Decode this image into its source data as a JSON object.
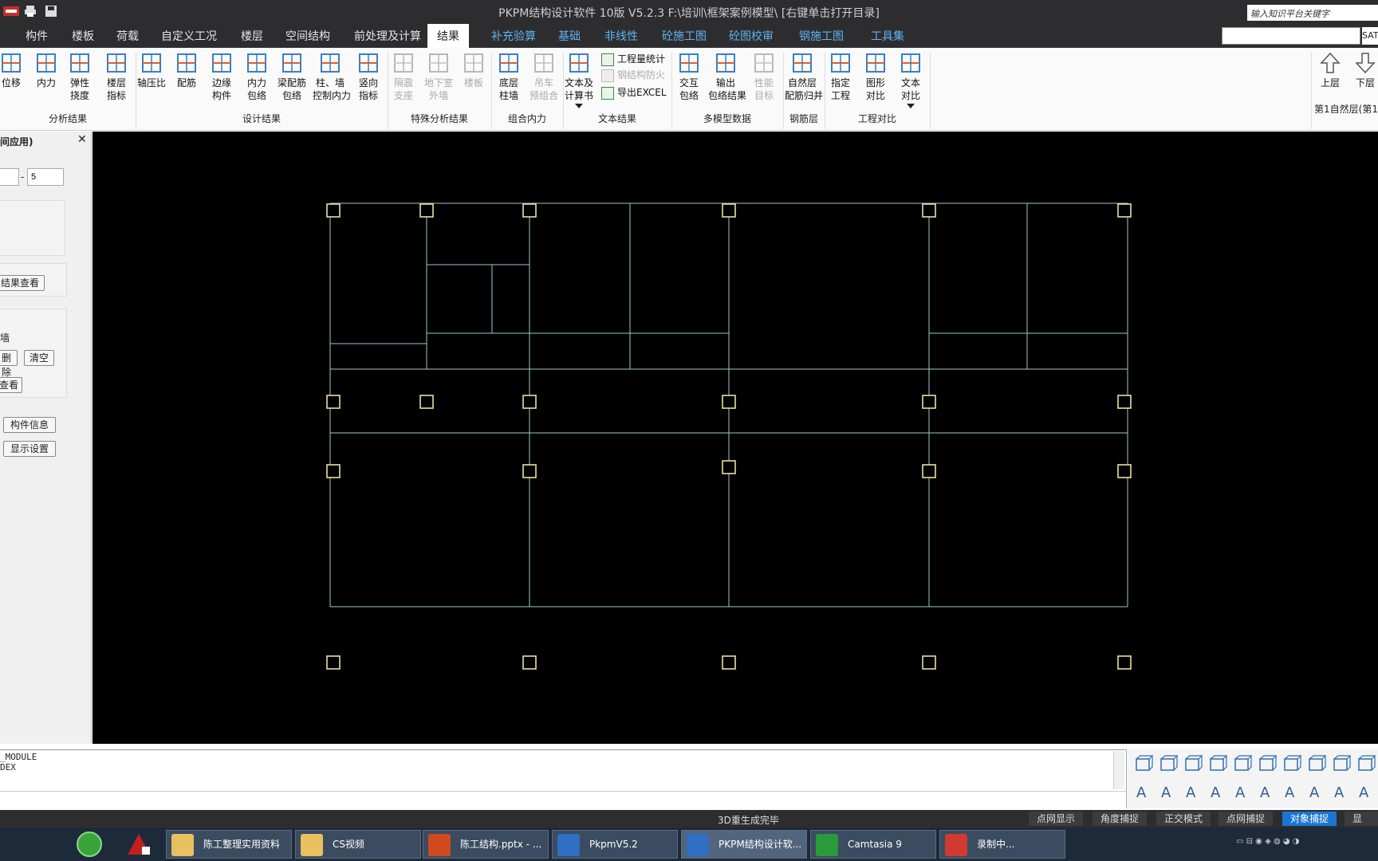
{
  "titlebar": {
    "title": "PKPM结构设计软件 10版 V5.2.3 F:\\培训\\框架案例模型\\  [右键单击打开目录]",
    "search_placeholder": "输入知识平台关键字"
  },
  "menu": {
    "tabs": [
      {
        "label": "构件",
        "style": "normal"
      },
      {
        "label": "楼板",
        "style": "normal"
      },
      {
        "label": "荷载",
        "style": "normal"
      },
      {
        "label": "自定义工况",
        "style": "normal"
      },
      {
        "label": "楼层",
        "style": "normal"
      },
      {
        "label": "空间结构",
        "style": "normal"
      },
      {
        "label": "前处理及计算",
        "style": "normal"
      },
      {
        "label": "结果",
        "style": "active"
      },
      {
        "label": "补充验算",
        "style": "blue"
      },
      {
        "label": "基础",
        "style": "blue"
      },
      {
        "label": "非线性",
        "style": "blue"
      },
      {
        "label": "砼施工图",
        "style": "blue"
      },
      {
        "label": "砼图校审",
        "style": "blue"
      },
      {
        "label": "钢施工图",
        "style": "blue"
      },
      {
        "label": "工具集",
        "style": "blue"
      }
    ],
    "combo_value": "",
    "combo2_value": "SAT"
  },
  "ribbon": {
    "buttons": [
      {
        "label": "位移",
        "enabled": true,
        "icon": "displacement-icon"
      },
      {
        "label": "内力",
        "enabled": true,
        "icon": "internal-force-icon"
      },
      {
        "label": "弹性\n挠度",
        "enabled": true,
        "icon": "deflection-icon"
      },
      {
        "label": "楼层\n指标",
        "enabled": true,
        "icon": "floor-index-icon"
      },
      {
        "label": "轴压比",
        "enabled": true,
        "icon": "axial-ratio-icon"
      },
      {
        "label": "配筋",
        "enabled": true,
        "icon": "reinforcement-icon"
      },
      {
        "label": "边缘\n构件",
        "enabled": true,
        "icon": "edge-member-icon"
      },
      {
        "label": "内力\n包络",
        "enabled": true,
        "icon": "force-envelope-icon"
      },
      {
        "label": "梁配筋\n包络",
        "enabled": true,
        "icon": "beam-envelope-icon"
      },
      {
        "label": "柱、墙\n控制内力",
        "enabled": true,
        "icon": "column-wall-icon"
      },
      {
        "label": "竖向\n指标",
        "enabled": true,
        "icon": "vertical-index-icon"
      },
      {
        "label": "隔震\n支座",
        "enabled": false,
        "icon": "isolation-icon"
      },
      {
        "label": "地下室\n外墙",
        "enabled": false,
        "icon": "basement-wall-icon"
      },
      {
        "label": "楼板",
        "enabled": false,
        "icon": "slab-icon"
      },
      {
        "label": "底层\n柱墙",
        "enabled": true,
        "icon": "bottom-column-icon"
      },
      {
        "label": "吊车\n预组合",
        "enabled": false,
        "icon": "crane-icon"
      },
      {
        "label": "文本及\n计算书",
        "enabled": true,
        "icon": "text-report-icon"
      },
      {
        "label": "交互\n包络",
        "enabled": true,
        "icon": "interactive-envelope-icon"
      },
      {
        "label": "输出\n包络结果",
        "enabled": true,
        "icon": "output-envelope-icon"
      },
      {
        "label": "性能\n目标",
        "enabled": false,
        "icon": "performance-icon"
      },
      {
        "label": "自然层\n配筋归并",
        "enabled": true,
        "icon": "floor-merge-icon"
      },
      {
        "label": "指定\n工程",
        "enabled": true,
        "icon": "folder-icon"
      },
      {
        "label": "图形\n对比",
        "enabled": true,
        "icon": "graphic-compare-icon"
      },
      {
        "label": "文本\n对比",
        "enabled": true,
        "icon": "text-compare-icon"
      },
      {
        "label": "上层",
        "enabled": true,
        "icon": "up-arrow-icon"
      },
      {
        "label": "下层",
        "enabled": true,
        "icon": "down-arrow-icon"
      }
    ],
    "small_buttons": [
      {
        "label": "工程量统计",
        "enabled": true
      },
      {
        "label": "钢结构防火",
        "enabled": false
      },
      {
        "label": "导出EXCEL",
        "enabled": true
      }
    ],
    "groups": [
      "分析结果",
      "设计结果",
      "特殊分析结果",
      "组合内力",
      "文本结果",
      "多模型数据",
      "钢筋层",
      "工程对比"
    ],
    "floor_label": "第1自然层(第1"
  },
  "left_panel": {
    "header": "间应用)",
    "close": "✕",
    "range_from": "",
    "range_dash": "-",
    "range_to": "5",
    "result_view_label": "结果查看",
    "wall_label": "墙",
    "delete_label": "删除",
    "clear_label": "清空",
    "view_label": "查看",
    "member_info_label": "构件信息",
    "display_settings_label": "显示设置"
  },
  "command_area": {
    "lines": [
      "_MODULE",
      "DEX"
    ]
  },
  "status": {
    "message": "3D重生成完毕",
    "buttons": [
      {
        "label": "点网显示",
        "on": false
      },
      {
        "label": "角度捕捉",
        "on": false
      },
      {
        "label": "正交模式",
        "on": false
      },
      {
        "label": "点网捕捉",
        "on": false
      },
      {
        "label": "对象捕捉",
        "on": true
      },
      {
        "label": "显示叉",
        "on": false
      }
    ]
  },
  "taskbar": {
    "tasks": [
      {
        "label": "陈工整理实用资料",
        "icon": "folder-icon"
      },
      {
        "label": "CS视频",
        "icon": "folder-icon"
      },
      {
        "label": "陈工结构.pptx - ...",
        "icon": "powerpoint-icon"
      },
      {
        "label": "PkpmV5.2",
        "icon": "pkpm-icon"
      },
      {
        "label": "PKPM结构设计软...",
        "icon": "pkpm-icon"
      },
      {
        "label": "Camtasia 9",
        "icon": "camtasia-icon"
      },
      {
        "label": "录制中...",
        "icon": "recording-icon"
      }
    ]
  },
  "colors": {
    "canvas_bg": "#000000",
    "grid_line": "#9fc8c8",
    "column_node": "#e8e0a0",
    "active_status": "#1976d2",
    "blue_tab": "#5fb4f0"
  }
}
